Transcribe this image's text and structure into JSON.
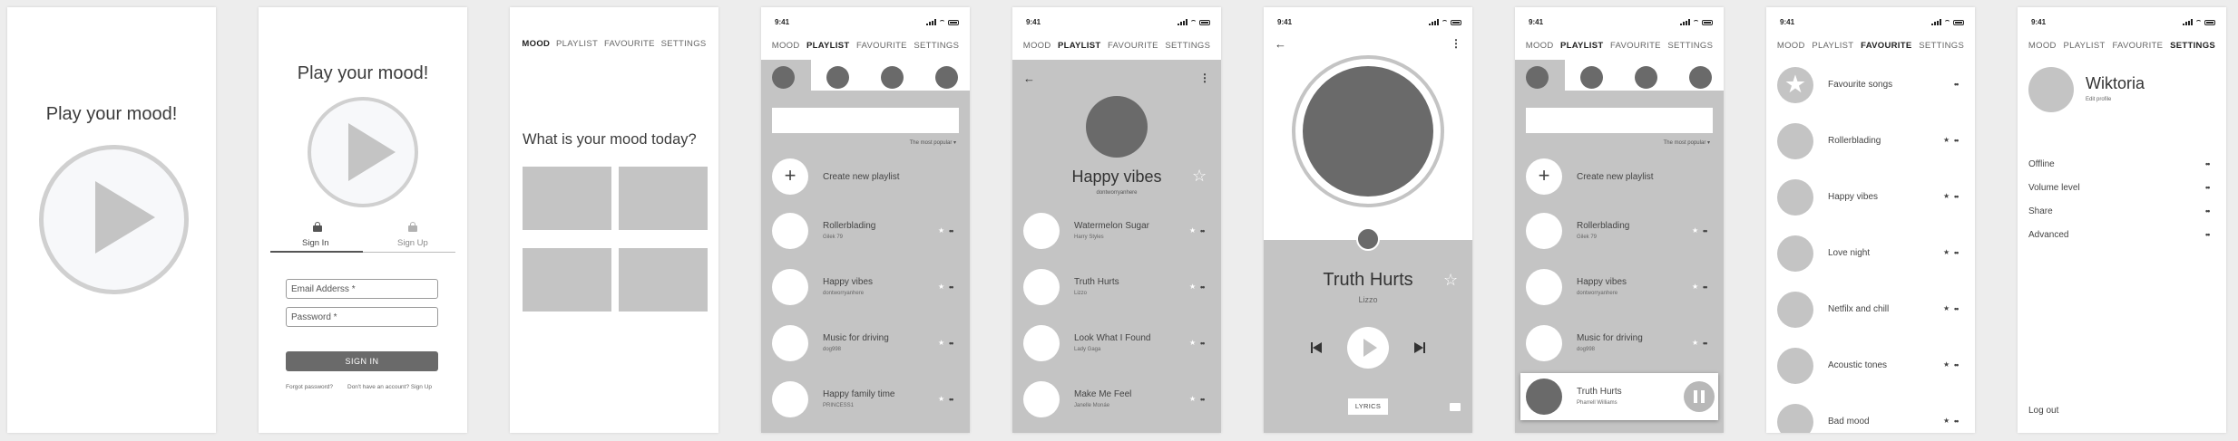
{
  "status": {
    "time": "9:41"
  },
  "nav": {
    "mood": "MOOD",
    "playlist": "PLAYLIST",
    "favourite": "FAVOURITE",
    "settings": "SETTINGS"
  },
  "splash": {
    "title": "Play your mood!"
  },
  "login": {
    "title": "Play your mood!",
    "tab_signin": "Sign In",
    "tab_signup": "Sign Up",
    "email_placeholder": "Email Adderss *",
    "password_placeholder": "Password *",
    "signin_button": "SIGN IN",
    "forgot": "Forgot password?",
    "no_account": "Don't have an account? Sign Up"
  },
  "mood": {
    "title": "What is your mood today?"
  },
  "playlist": {
    "sort": "The most popular ▾",
    "create": "Create new playlist",
    "items": [
      {
        "title": "Rollerblading",
        "sub": "Gilek 79"
      },
      {
        "title": "Happy vibes",
        "sub": "dontworryanhere"
      },
      {
        "title": "Music for driving",
        "sub": "dog998"
      },
      {
        "title": "Happy family time",
        "sub": "PRINCESS1"
      }
    ],
    "items_short": [
      {
        "title": "Rollerblading",
        "sub": "Gilek 79"
      },
      {
        "title": "Happy vibes",
        "sub": "dontworryanhere"
      },
      {
        "title": "Music for driving",
        "sub": "dog998"
      }
    ],
    "now_playing": {
      "title": "Truth Hurts",
      "sub": "Pharrell Williams"
    }
  },
  "detail": {
    "title": "Happy vibes",
    "sub": "dontworryanhere",
    "songs": [
      {
        "title": "Watermelon Sugar",
        "sub": "Harry Styles"
      },
      {
        "title": "Truth Hurts",
        "sub": "Lizzo"
      },
      {
        "title": "Look What I Found",
        "sub": "Lady Gaga"
      },
      {
        "title": "Make Me Feel",
        "sub": "Janelle Monáe"
      }
    ]
  },
  "player": {
    "title": "Truth Hurts",
    "artist": "Lizzo",
    "lyrics": "LYRICS"
  },
  "favourite": {
    "items": [
      {
        "title": "Favourite songs"
      },
      {
        "title": "Rollerblading"
      },
      {
        "title": "Happy vibes"
      },
      {
        "title": "Love night"
      },
      {
        "title": "Netfilx and chill"
      },
      {
        "title": "Acoustic tones"
      },
      {
        "title": "Bad mood"
      }
    ]
  },
  "settings": {
    "name": "Wiktoria",
    "edit": "Edit profile",
    "options": [
      "Offline",
      "Volume level",
      "Share",
      "Advanced"
    ],
    "logout": "Log out"
  },
  "glyphs": {
    "dots": "••",
    "star": "★",
    "star_outline": "☆",
    "back": "←",
    "menu": "⋮",
    "plus": "+"
  },
  "colors": {
    "placeholder": "#c4c4c4",
    "dark": "#6a6a6a",
    "ring": "#d0d0d0"
  }
}
